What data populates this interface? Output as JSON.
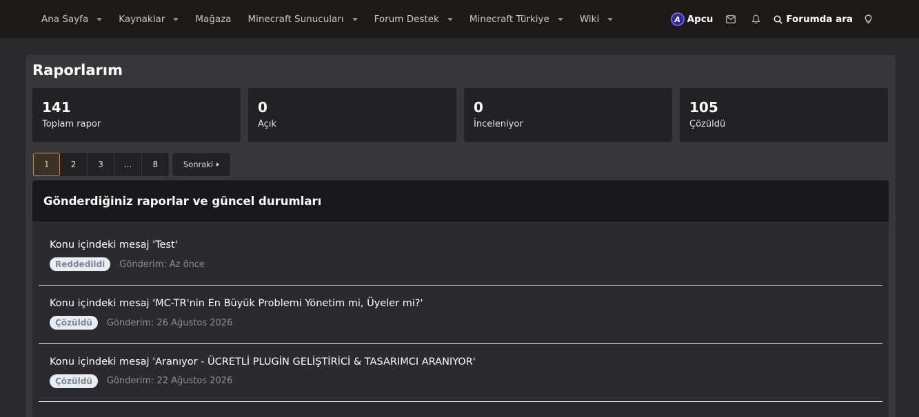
{
  "nav": {
    "items": [
      {
        "label": "Ana Sayfa",
        "dropdown": true
      },
      {
        "label": "Kaynaklar",
        "dropdown": true
      },
      {
        "label": "Mağaza",
        "dropdown": false
      },
      {
        "label": "Minecraft Sunucuları",
        "dropdown": true
      },
      {
        "label": "Forum Destek",
        "dropdown": true
      },
      {
        "label": "Minecraft Türkiye",
        "dropdown": true
      },
      {
        "label": "Wiki",
        "dropdown": true
      }
    ],
    "user": {
      "name": "Apcu",
      "avatar_letter": "A"
    },
    "icons": [
      "mail-icon",
      "bell-icon",
      "bulb-icon"
    ],
    "search_label": "Forumda ara"
  },
  "page": {
    "title": "Raporlarım",
    "stats": [
      {
        "value": "141",
        "label": "Toplam rapor"
      },
      {
        "value": "0",
        "label": "Açık"
      },
      {
        "value": "0",
        "label": "İnceleniyor"
      },
      {
        "value": "105",
        "label": "Çözüldü"
      }
    ],
    "pagination": {
      "pages": [
        "1",
        "2",
        "3",
        "…",
        "8"
      ],
      "current": "1",
      "next_label": "Sonraki"
    },
    "reports_header": "Gönderdiğiniz raporlar ve güncel durumları",
    "reports": [
      {
        "title": "Konu içindeki mesaj 'Test'",
        "status": "Reddedildi",
        "sent": "Gönderim: Az önce"
      },
      {
        "title": "Konu içindeki mesaj 'MC-TR'nin En Büyük Problemi Yönetim mi, Üyeler mi?'",
        "status": "Çözüldü",
        "sent": "Gönderim: 26 Ağustos 2026"
      },
      {
        "title": "Konu içindeki mesaj 'Aranıyor - ÜCRETLİ PLUGİN GELİŞTİRİCİ & TASARIMCI ARANIYOR'",
        "status": "Çözüldü",
        "sent": "Gönderim: 22 Ağustos 2026"
      }
    ]
  }
}
